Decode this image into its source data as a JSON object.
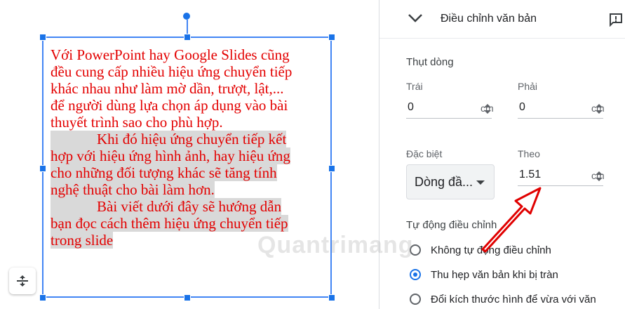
{
  "slide_text": {
    "lines": [
      "Với PowerPoint hay Google Slides cũng",
      "đều cung cấp nhiều hiệu ứng chuyển tiếp",
      "khác nhau như làm mờ dần, trượt, lật,...",
      "để người dùng lựa chọn áp dụng vào bài",
      "thuyết trình sao cho phù hợp.",
      "Khi đó hiệu ứng chuyển tiếp kết",
      "hợp với hiệu ứng hình ảnh, hay hiệu ứng",
      "cho những đối tượng khác sẽ tăng tính",
      "nghệ thuật cho bài làm hơn.",
      "Bài viết dưới đây sẽ hướng dẫn",
      "bạn đọc cách thêm hiệu ứng chuyển tiếp",
      "trong slide"
    ],
    "color": "#e30000",
    "highlight_color": "#d9d9d9"
  },
  "panel": {
    "title": "Điều chỉnh văn bản",
    "indent": {
      "title": "Thụt dòng",
      "left_label": "Trái",
      "left_value": "0",
      "right_label": "Phải",
      "right_value": "0",
      "unit": "cm",
      "special_label": "Đặc biệt",
      "special_value": "Dòng đầ...",
      "by_label": "Theo",
      "by_value": "1.51"
    },
    "autofit": {
      "title": "Tự động điều chỉnh",
      "options": [
        {
          "label": "Không tự động điều chỉnh",
          "selected": false
        },
        {
          "label": "Thu hẹp văn bản khi bị tràn",
          "selected": true
        },
        {
          "label": "Đổi kích thước hình để vừa với văn",
          "selected": false
        }
      ]
    }
  },
  "accent_color": "#1a73e8",
  "annotation_arrow_color": "#e00000",
  "watermark": "Quantrimang"
}
